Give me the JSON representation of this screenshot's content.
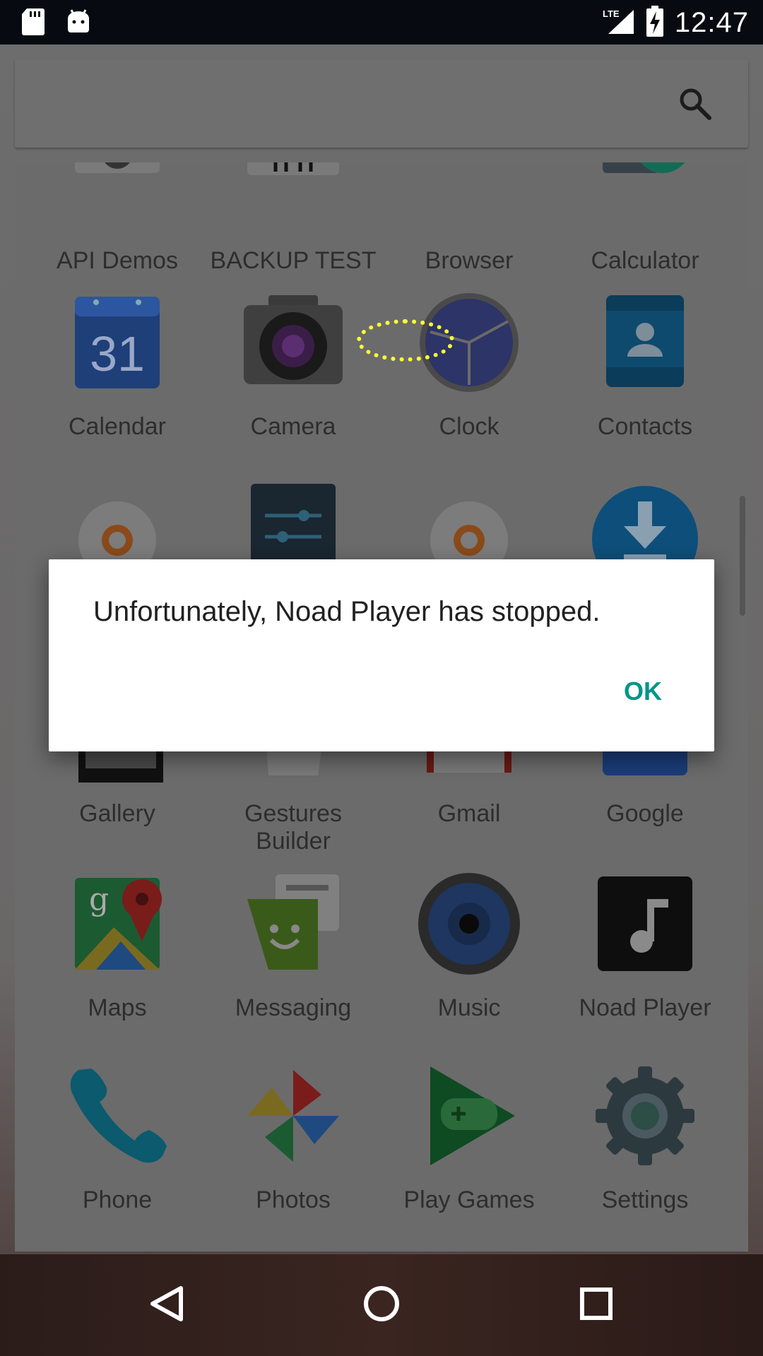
{
  "status_bar": {
    "time": "12:47",
    "network": "LTE",
    "icons": [
      "sd-card-icon",
      "android-icon",
      "lte-signal-icon",
      "battery-charging-icon"
    ]
  },
  "search": {
    "icon": "search-icon"
  },
  "apps": [
    {
      "label": "API Demos",
      "icon": "settings-gear-icon"
    },
    {
      "label": "BACKUP TEST",
      "icon": "sheep-icon"
    },
    {
      "label": "Browser",
      "icon": "globe-icon"
    },
    {
      "label": "Calculator",
      "icon": "calculator-icon"
    },
    {
      "label": "Calendar",
      "icon": "calendar-icon",
      "day": "31"
    },
    {
      "label": "Camera",
      "icon": "camera-icon"
    },
    {
      "label": "Clock",
      "icon": "clock-icon"
    },
    {
      "label": "Contacts",
      "icon": "contacts-icon"
    },
    {
      "label": "Gallery",
      "icon": "gallery-icon"
    },
    {
      "label": "Gestures Builder",
      "icon": "gestures-icon"
    },
    {
      "label": "Gmail",
      "icon": "gmail-icon"
    },
    {
      "label": "Google",
      "icon": "google-icon"
    },
    {
      "label": "Maps",
      "icon": "maps-icon"
    },
    {
      "label": "Messaging",
      "icon": "messaging-icon"
    },
    {
      "label": "Music",
      "icon": "music-speaker-icon"
    },
    {
      "label": "Noad Player",
      "icon": "music-note-icon"
    },
    {
      "label": "Phone",
      "icon": "phone-icon"
    },
    {
      "label": "Photos",
      "icon": "photos-pinwheel-icon"
    },
    {
      "label": "Play Games",
      "icon": "play-games-icon"
    },
    {
      "label": "Settings",
      "icon": "settings-icon"
    }
  ],
  "dialog": {
    "message": "Unfortunately, Noad Player has stopped.",
    "ok_label": "OK"
  },
  "colors": {
    "accent": "#009688",
    "status_bar": "#070b11",
    "dialog_bg": "#ffffff"
  },
  "nav": {
    "back_icon": "back-triangle-icon",
    "home_icon": "home-circle-icon",
    "recents_icon": "recents-square-icon"
  }
}
